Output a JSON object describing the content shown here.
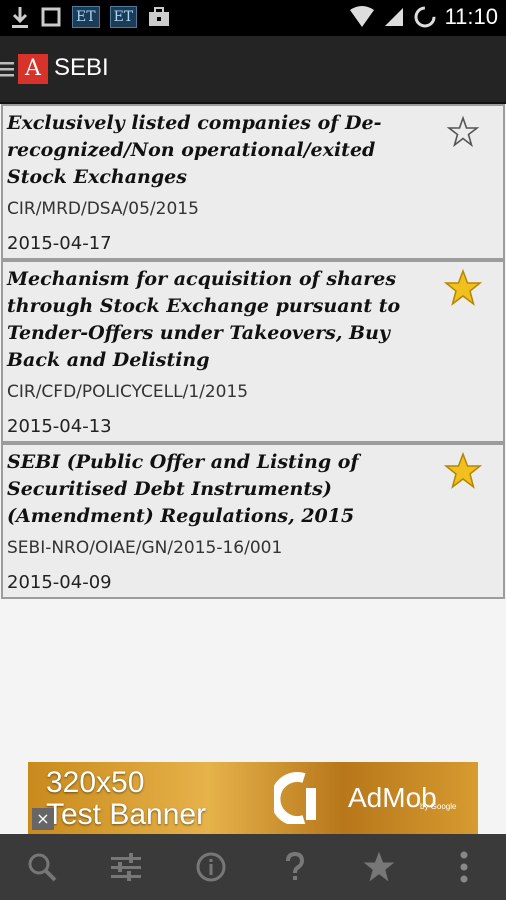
{
  "status_bar": {
    "time": "11:10",
    "notif_et_1": "ET",
    "notif_et_2": "ET"
  },
  "app_bar": {
    "logo_text": "A",
    "title": "SEBI"
  },
  "items": [
    {
      "title": "Exclusively listed companies of De-recognized/Non operational/exited Stock Exchanges",
      "code": "CIR/MRD/DSA/05/2015",
      "date": "2015-04-17",
      "starred": false
    },
    {
      "title": "Mechanism for acquisition of shares through Stock Exchange pursuant to Tender-Offers under Takeovers, Buy Back and Delisting",
      "code": "CIR/CFD/POLICYCELL/1/2015",
      "date": "2015-04-13",
      "starred": true
    },
    {
      "title": "SEBI (Public Offer and Listing of Securitised Debt Instruments) (Amendment) Regulations, 2015",
      "code": "SEBI-NRO/OIAE/GN/2015-16/001",
      "date": "2015-04-09",
      "starred": true
    }
  ],
  "ad": {
    "line1": "320x50",
    "line2": "Test Banner",
    "brand": "AdMob",
    "by": "by Google",
    "close": "×"
  },
  "colors": {
    "star_filled": "#f2c01e",
    "accent_logo": "#d8332a"
  },
  "toolbar_icons": [
    "search-icon",
    "filter-sliders-icon",
    "info-icon",
    "help-icon",
    "star-icon",
    "overflow-menu-icon"
  ]
}
